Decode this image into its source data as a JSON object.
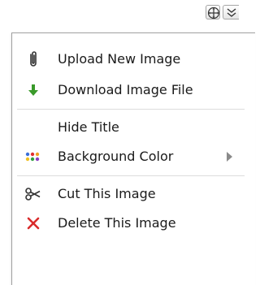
{
  "toolbar": {
    "move_icon": "move-arrows-icon",
    "collapse_icon": "double-chevron-down-icon"
  },
  "menu": {
    "items": [
      {
        "label": "Upload New Image",
        "icon": "paperclip-icon"
      },
      {
        "label": "Download Image File",
        "icon": "download-arrow-icon",
        "icon_color": "#3a9a2a"
      },
      {
        "label": "Hide Title",
        "icon": ""
      },
      {
        "label": "Background Color",
        "icon": "color-dots-icon",
        "has_submenu": true
      },
      {
        "label": "Cut This Image",
        "icon": "scissors-icon"
      },
      {
        "label": "Delete This Image",
        "icon": "delete-x-icon",
        "icon_color": "#d92b2b"
      }
    ]
  }
}
